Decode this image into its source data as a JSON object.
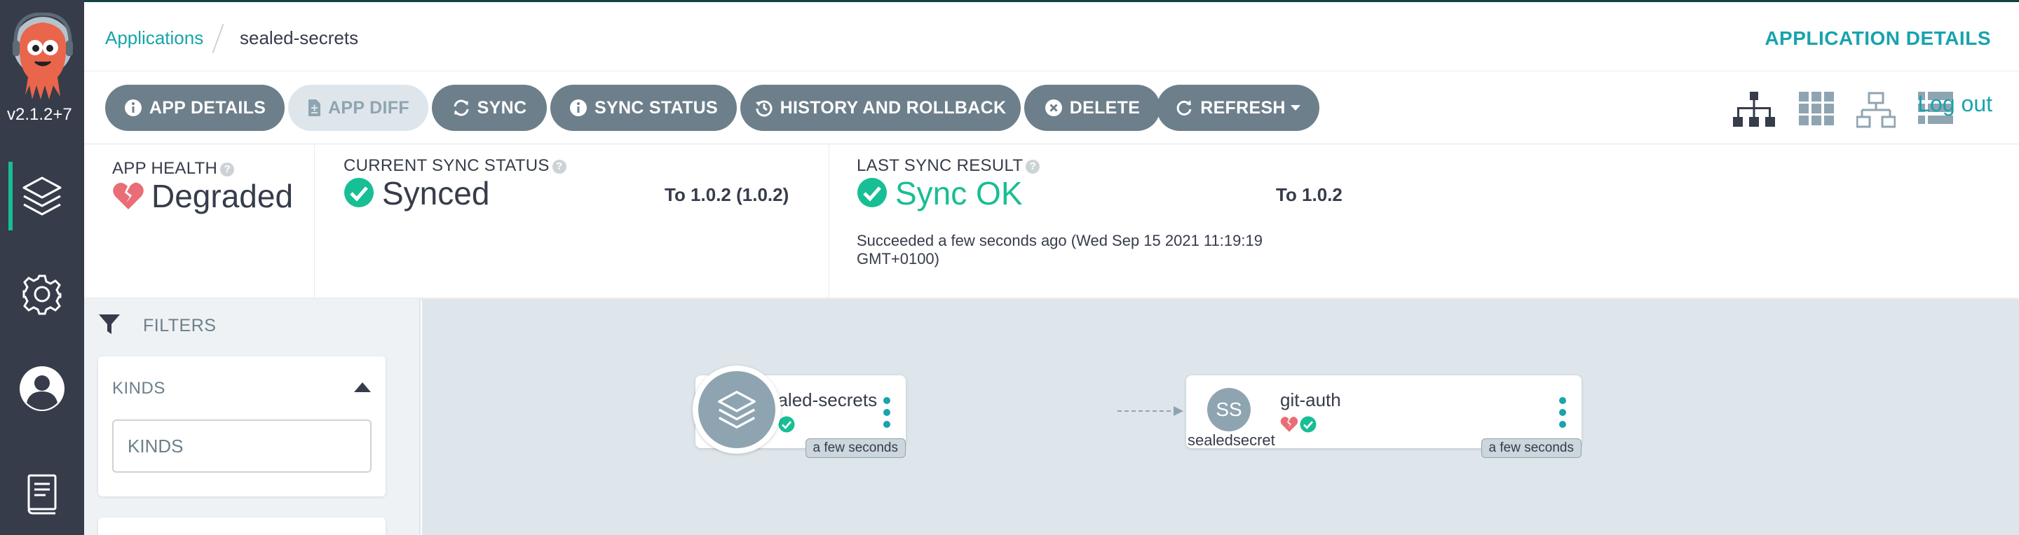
{
  "nav": {
    "version": "v2.1.2+7",
    "items": [
      {
        "name": "applications",
        "icon": "layers-icon",
        "active": true
      },
      {
        "name": "settings",
        "icon": "gear-icon",
        "active": false
      },
      {
        "name": "user-info",
        "icon": "user-icon",
        "active": false
      },
      {
        "name": "documentation",
        "icon": "book-icon",
        "active": false
      }
    ]
  },
  "breadcrumb": {
    "root": "Applications",
    "current": "sealed-secrets"
  },
  "header": {
    "title": "APPLICATION DETAILS"
  },
  "toolbar": {
    "app_details": "APP DETAILS",
    "app_diff": "APP DIFF",
    "sync": "SYNC",
    "sync_status": "SYNC STATUS",
    "history": "HISTORY AND ROLLBACK",
    "delete": "DELETE",
    "refresh": "REFRESH",
    "logout": "Log out",
    "views": [
      "tree-view-icon",
      "pods-view-icon",
      "network-view-icon",
      "list-view-icon"
    ]
  },
  "status": {
    "health": {
      "label": "APP HEALTH",
      "value": "Degraded",
      "color": "#e96d76"
    },
    "sync": {
      "label": "CURRENT SYNC STATUS",
      "value": "Synced",
      "revision": "To 1.0.2 (1.0.2)",
      "color": "#18be94"
    },
    "last_sync": {
      "label": "LAST SYNC RESULT",
      "value": "Sync OK",
      "revision": "To 1.0.2",
      "detail": "Succeeded a few seconds ago (Wed Sep 15 2021 11:19:19 GMT+0100)",
      "color": "#18be94"
    }
  },
  "filters": {
    "title": "FILTERS",
    "kinds": {
      "title": "KINDS",
      "placeholder": "KINDS",
      "value": ""
    }
  },
  "graph": {
    "nodes": [
      {
        "name": "sealed-secrets",
        "kind": "",
        "icon": "layers-icon",
        "age": "a few seconds",
        "health": "degraded",
        "sync": "synced"
      },
      {
        "name": "git-auth",
        "kind": "sealedsecret",
        "icon_text": "SS",
        "age": "a few seconds",
        "health": "degraded",
        "sync": "synced"
      }
    ]
  },
  "colors": {
    "accent": "#18a3ad",
    "nav_bg": "#363c4a",
    "button_bg": "#6d7f8b",
    "healthy": "#18be94",
    "degraded": "#e96d76",
    "canvas_bg": "#dee6eb"
  }
}
